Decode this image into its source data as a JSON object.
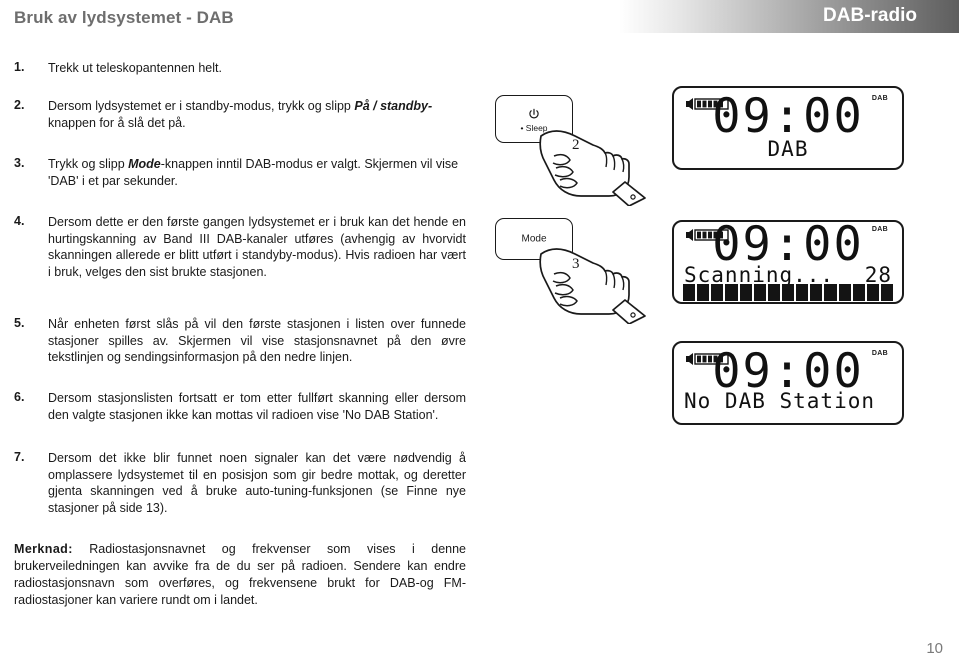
{
  "header": {
    "title": "Bruk av lydsystemet - DAB",
    "band_label": "DAB-radio"
  },
  "steps": [
    {
      "number": "1.",
      "text": "Trekk ut teleskopantennen helt."
    },
    {
      "number": "2.",
      "text_before": "Dersom lydsystemet er i standby-modus, trykk og slipp ",
      "emphasis": "På / standby-",
      "text_after": "knappen for å slå det på."
    },
    {
      "number": "3.",
      "text_before": "Trykk og slipp ",
      "emphasis": "Mode",
      "text_after": "-knappen inntil DAB-modus er valgt. Skjermen vil vise 'DAB' i et par sekunder."
    },
    {
      "number": "4.",
      "text": "Dersom dette er den første gangen lydsystemet er i bruk kan det hende en hurtingskanning av Band III DAB-kanaler utføres (avhengig av hvorvidt skanningen allerede er blitt utført i standyby-modus). Hvis radioen har vært i bruk, velges den sist brukte stasjonen."
    },
    {
      "number": "5.",
      "text": "Når enheten først slås på vil den første stasjonen i listen over funnede stasjoner spilles av. Skjermen vil vise stasjonsnavnet på den øvre tekstlinjen og sendingsinformasjon på den nedre linjen."
    },
    {
      "number": "6.",
      "text": "Dersom stasjonslisten fortsatt er tom etter fullført skanning eller dersom den valgte stasjonen ikke kan mottas vil radioen vise 'No DAB Station'."
    },
    {
      "number": "7.",
      "text": "Dersom det ikke blir funnet noen signaler kan det være nødvendig å omplassere lydsystemet til en posisjon som gir bedre mottak, og deretter gjenta skanningen ved å bruke auto-tuning-funksjonen (se Finne nye stasjoner på side 13)."
    }
  ],
  "note": {
    "lead": "Merknad:",
    "text": " Radiostasjonsnavnet og frekvenser som vises i denne brukerveiledningen kan avvike fra de du ser på radioen. Sendere kan endre radiostasjonsnavn som overføres, og frekvensene brukt for DAB-og FM-radiostasjoner kan variere rundt om i landet."
  },
  "buttons": [
    {
      "icon": "power-icon",
      "power_glyph": "⏻",
      "sub_label": "• Sleep",
      "hand_number": "2"
    },
    {
      "icon": "mode-button-icon",
      "label": "Mode",
      "hand_number": "3"
    }
  ],
  "displays": [
    {
      "name": "lcd-dab-confirm",
      "speaker_icon": "speaker-volume-icon",
      "indicator": "DAB",
      "clock": "09:00",
      "line1": "DAB",
      "line1_align": "center",
      "bar_blocks": 0,
      "right_value": ""
    },
    {
      "name": "lcd-scanning",
      "speaker_icon": "speaker-volume-icon",
      "indicator": "DAB",
      "clock": "09:00",
      "line1": "Scanning...",
      "line1_align": "left",
      "right_value": "28",
      "bar_blocks": 15
    },
    {
      "name": "lcd-no-station",
      "speaker_icon": "speaker-volume-icon",
      "indicator": "DAB",
      "clock": "09:00",
      "line1": "No DAB Station",
      "line1_align": "left",
      "bar_blocks": 0,
      "right_value": ""
    }
  ],
  "footer": {
    "page_number": "10"
  },
  "colors": {
    "title_gray": "#6e6e6e",
    "band_dark": "#5e5e5e",
    "text_black": "#1a1a1a",
    "page_number_gray": "#7a7a7a"
  }
}
